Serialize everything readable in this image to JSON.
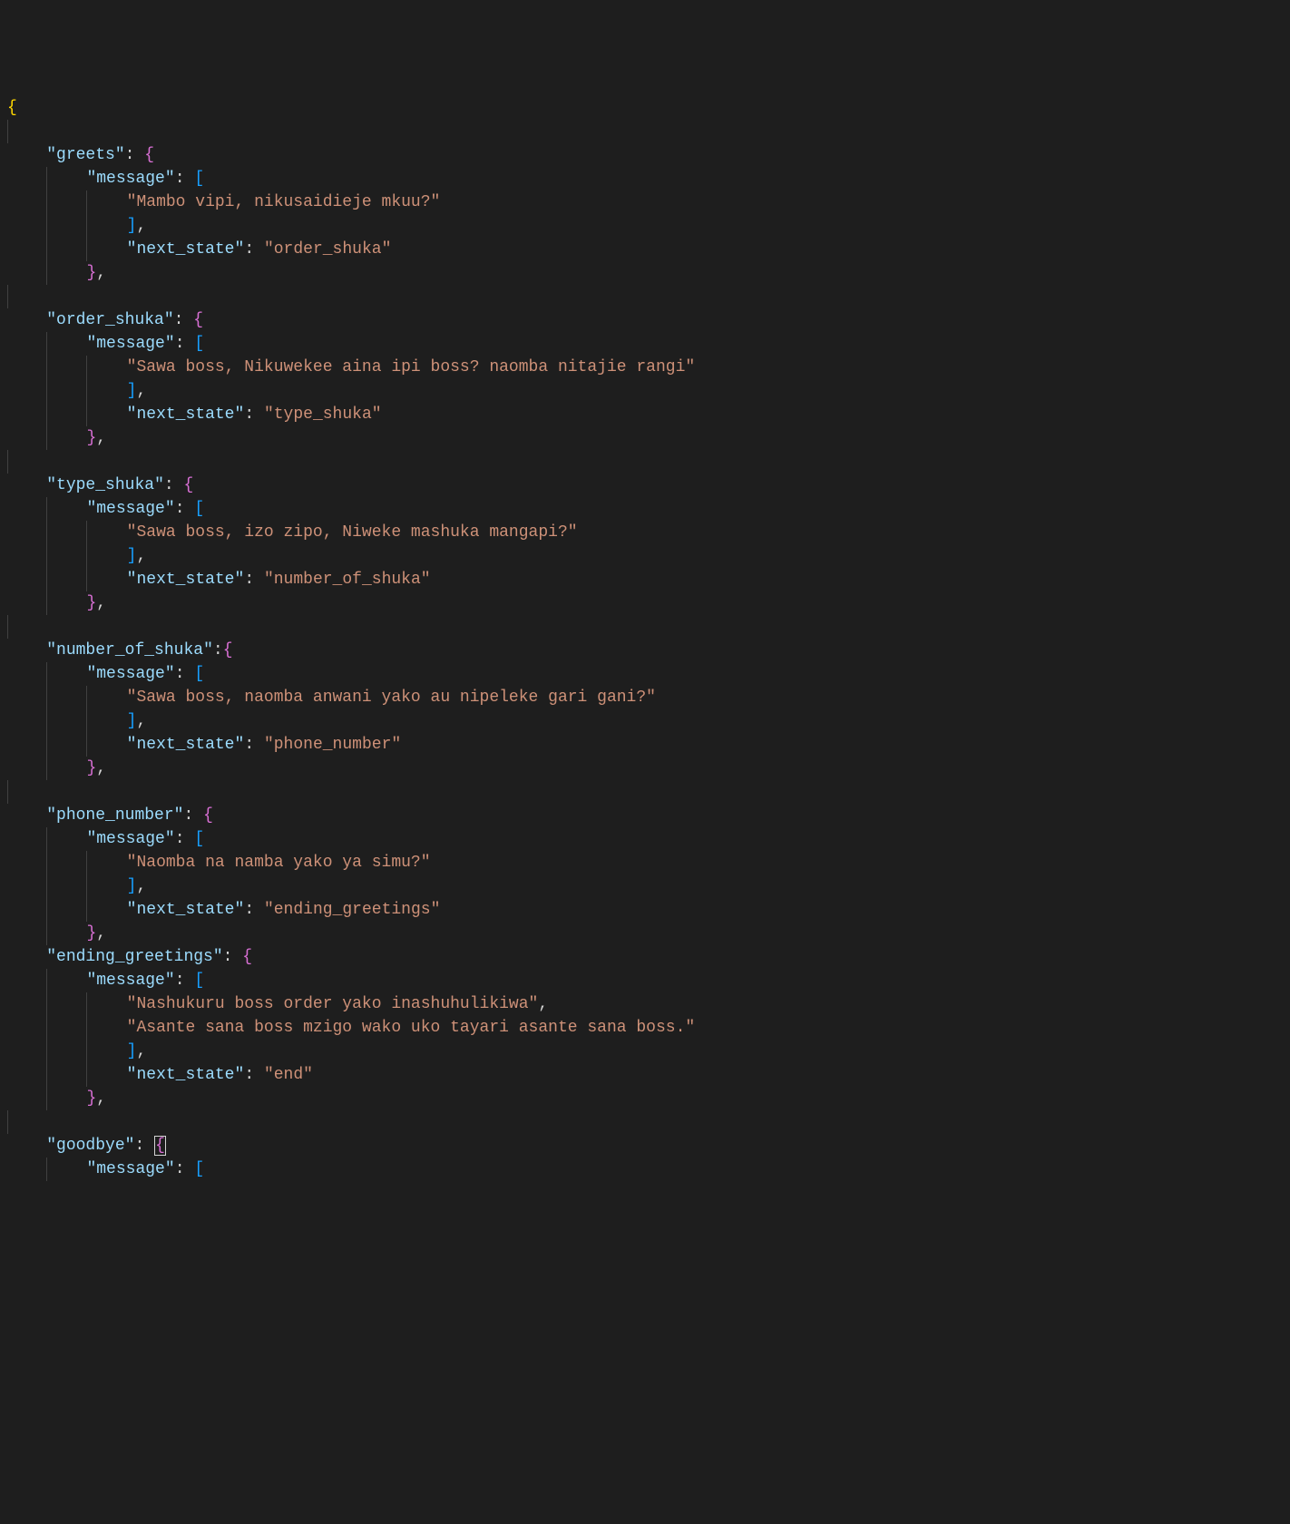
{
  "code": {
    "states": [
      {
        "name": "greets",
        "messages": [
          "Mambo vipi, nikusaidieje mkuu?"
        ],
        "next_state": "order_shuka"
      },
      {
        "name": "order_shuka",
        "messages": [
          "Sawa boss, Nikuwekee aina ipi boss? naomba nitajie rangi"
        ],
        "next_state": "type_shuka"
      },
      {
        "name": "type_shuka",
        "messages": [
          "Sawa boss, izo zipo, Niweke mashuka mangapi?"
        ],
        "next_state": "number_of_shuka"
      },
      {
        "name": "number_of_shuka",
        "messages": [
          "Sawa boss, naomba anwani yako au nipeleke gari gani?"
        ],
        "next_state": "phone_number",
        "no_space_before_brace": true
      },
      {
        "name": "phone_number",
        "messages": [
          "Naomba na namba yako ya simu?"
        ],
        "next_state": "ending_greetings"
      },
      {
        "name": "ending_greetings",
        "messages": [
          "Nashukuru boss order yako inashuhulikiwa",
          "Asante sana boss mzigo wako uko tayari asante sana boss."
        ],
        "next_state": "end",
        "close_indent": 2
      },
      {
        "name": "goodbye",
        "messages_partial": true,
        "cursor": true
      }
    ],
    "labels": {
      "message_key": "message",
      "next_state_key": "next_state"
    }
  }
}
